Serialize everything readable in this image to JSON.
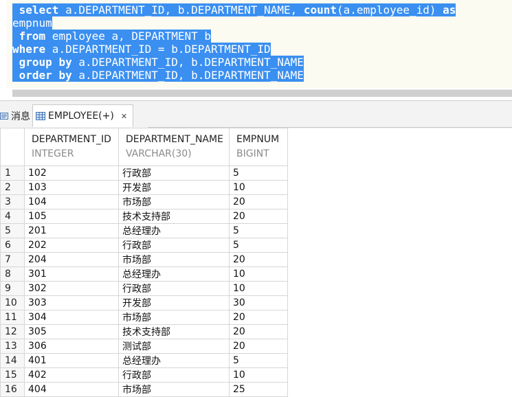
{
  "editor": {
    "lines": [
      [
        {
          "t": " ",
          "kw": false
        },
        {
          "t": "select",
          "kw": true
        },
        {
          "t": " a.DEPARTMENT_ID, b.DEPARTMENT_NAME, ",
          "kw": false
        },
        {
          "t": "count",
          "kw": true
        },
        {
          "t": "(a.employee_id) ",
          "kw": false
        },
        {
          "t": "as",
          "kw": true
        }
      ],
      [
        {
          "t": "empnum",
          "kw": false
        }
      ],
      [
        {
          "t": " ",
          "kw": false
        },
        {
          "t": "from",
          "kw": true
        },
        {
          "t": " employee a, DEPARTMENT b",
          "kw": false
        }
      ],
      [
        {
          "t": "where",
          "kw": true
        },
        {
          "t": " a.DEPARTMENT_ID = b.DEPARTMENT_ID",
          "kw": false
        }
      ],
      [
        {
          "t": " ",
          "kw": false
        },
        {
          "t": "group by",
          "kw": true
        },
        {
          "t": " a.DEPARTMENT_ID, b.DEPARTMENT_NAME",
          "kw": false
        }
      ],
      [
        {
          "t": " ",
          "kw": false
        },
        {
          "t": "order by",
          "kw": true
        },
        {
          "t": " a.DEPARTMENT_ID, b.DEPARTMENT_NAME",
          "kw": false
        }
      ]
    ]
  },
  "tabs": {
    "messages_label": "消息",
    "result_label": "EMPLOYEE(+)",
    "close_glyph": "✕"
  },
  "grid": {
    "columns": [
      {
        "name": "DEPARTMENT_ID",
        "type": "INTEGER"
      },
      {
        "name": "DEPARTMENT_NAME",
        "type": "VARCHAR(30)"
      },
      {
        "name": "EMPNUM",
        "type": "BIGINT"
      }
    ],
    "rows": [
      [
        "1",
        "102",
        "行政部",
        "5"
      ],
      [
        "2",
        "103",
        "开发部",
        "10"
      ],
      [
        "3",
        "104",
        "市场部",
        "20"
      ],
      [
        "4",
        "105",
        "技术支持部",
        "20"
      ],
      [
        "5",
        "201",
        "总经理办",
        "5"
      ],
      [
        "6",
        "202",
        "行政部",
        "5"
      ],
      [
        "7",
        "204",
        "市场部",
        "20"
      ],
      [
        "8",
        "301",
        "总经理办",
        "10"
      ],
      [
        "9",
        "302",
        "行政部",
        "10"
      ],
      [
        "10",
        "303",
        "开发部",
        "30"
      ],
      [
        "11",
        "304",
        "市场部",
        "20"
      ],
      [
        "12",
        "305",
        "技术支持部",
        "20"
      ],
      [
        "13",
        "306",
        "测试部",
        "20"
      ],
      [
        "14",
        "401",
        "总经理办",
        "5"
      ],
      [
        "15",
        "402",
        "行政部",
        "10"
      ],
      [
        "16",
        "404",
        "市场部",
        "25"
      ]
    ]
  }
}
